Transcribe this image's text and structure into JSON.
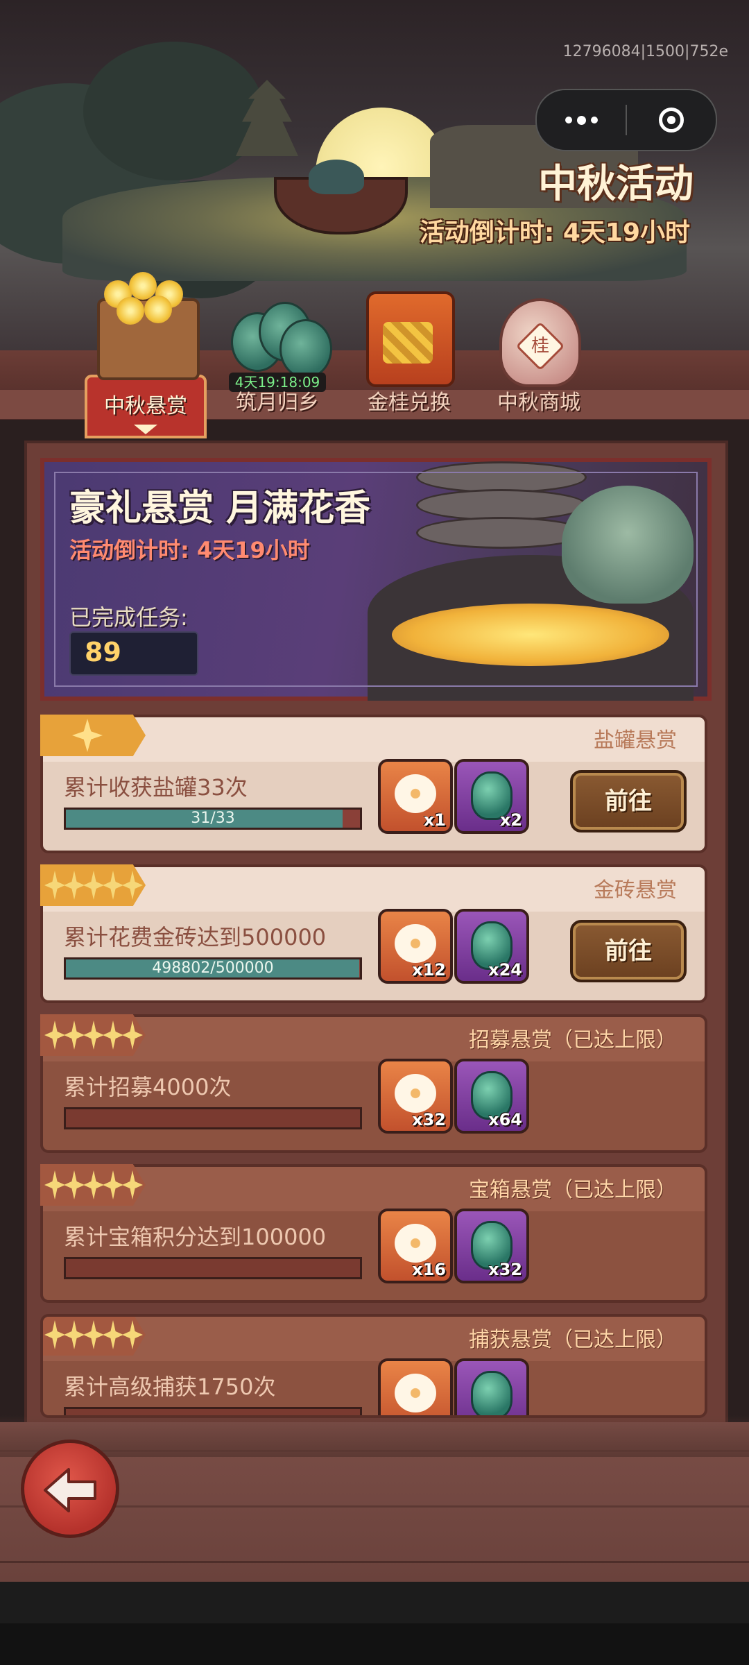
{
  "status": {
    "debug_id": "12796084|1500|752e"
  },
  "header": {
    "title": "中秋活动",
    "countdown": "活动倒计时: 4天19小时"
  },
  "tabs": [
    {
      "label": "中秋悬赏",
      "active": true,
      "icon": "osmanthus-basket-icon"
    },
    {
      "label": "筑月归乡",
      "timer": "4天19:18:09",
      "icon": "jade-tiles-icon"
    },
    {
      "label": "金桂兑换",
      "icon": "gift-box-icon"
    },
    {
      "label": "中秋商城",
      "icon": "wine-jar-icon",
      "jar_text": "桂"
    }
  ],
  "banner": {
    "title": "豪礼悬赏 月满花香",
    "countdown": "活动倒计时: 4天19小时",
    "completed_label": "已完成任务:",
    "completed_value": "89"
  },
  "bounties": [
    {
      "type": "盐罐悬赏",
      "desc": "累计收获盐罐33次",
      "progress": "31/33",
      "progress_fraction": 0.94,
      "rewards": [
        {
          "icon": "flower-icon",
          "qty": "x1"
        },
        {
          "icon": "jade-icon",
          "qty": "x2"
        }
      ],
      "button": "前往",
      "stars": 1
    },
    {
      "type": "金砖悬赏",
      "desc": "累计花费金砖达到500000",
      "progress": "498802/500000",
      "progress_fraction": 0.998,
      "rewards": [
        {
          "icon": "flower-icon",
          "qty": "x12"
        },
        {
          "icon": "jade-icon",
          "qty": "x24"
        }
      ],
      "button": "前往",
      "stars": 5
    },
    {
      "type": "招募悬赏（已达上限）",
      "desc": "累计招募4000次",
      "rewards": [
        {
          "icon": "flower-icon",
          "qty": "x32"
        },
        {
          "icon": "jade-icon",
          "qty": "x64"
        }
      ],
      "stars": 5
    },
    {
      "type": "宝箱悬赏（已达上限）",
      "desc": "累计宝箱积分达到100000",
      "rewards": [
        {
          "icon": "flower-icon",
          "qty": "x16"
        },
        {
          "icon": "jade-icon",
          "qty": "x32"
        }
      ],
      "stars": 5
    },
    {
      "type": "捕获悬赏（已达上限）",
      "desc": "累计高级捕获1750次",
      "stars": 5
    }
  ],
  "colors": {
    "accent_red": "#b8332c",
    "progress_teal": "#4c8a84",
    "gold": "#ffd26a"
  }
}
